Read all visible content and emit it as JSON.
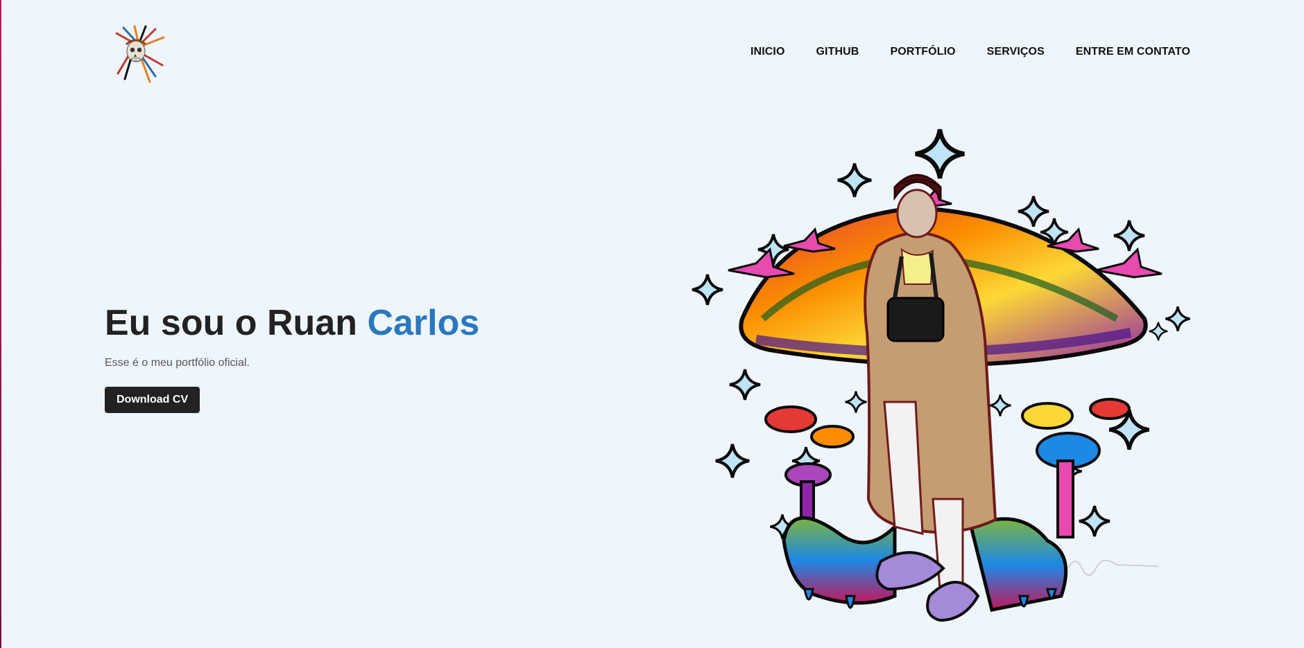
{
  "nav": {
    "items": [
      "INICIO",
      "GITHUB",
      "PORTFÓLIO",
      "SERVIÇOS",
      "ENTRE EM CONTATO"
    ]
  },
  "hero": {
    "title_prefix": "Eu sou o Ruan ",
    "title_accent": "Carlos",
    "subtitle": "Esse é o meu portfólio oficial.",
    "button_label": "Download CV"
  },
  "colors": {
    "background": "#eff5fd",
    "accent": "#2a78bd",
    "button_bg": "#222222",
    "text": "#222222"
  },
  "icons": {
    "logo": "skull-headdress-logo",
    "illustration": "psychedelic-mushroom-person-illustration"
  }
}
